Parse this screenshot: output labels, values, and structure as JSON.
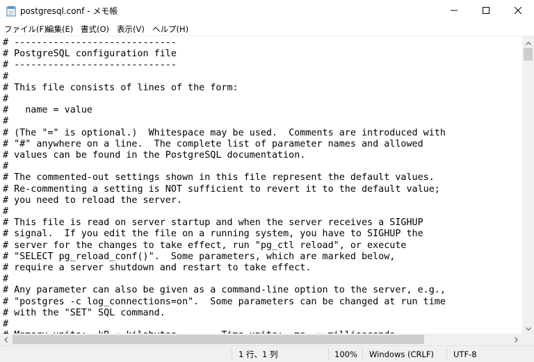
{
  "window": {
    "title": "postgresql.conf - メモ帳",
    "icon": "notepad-icon"
  },
  "menu": [
    {
      "label": "ファイル(F)"
    },
    {
      "label": "編集(E)"
    },
    {
      "label": "書式(O)"
    },
    {
      "label": "表示(V)"
    },
    {
      "label": "ヘルプ(H)"
    }
  ],
  "editor": {
    "lines": [
      "# -----------------------------",
      "# PostgreSQL configuration file",
      "# -----------------------------",
      "#",
      "# This file consists of lines of the form:",
      "#",
      "#   name = value",
      "#",
      "# (The \"=\" is optional.)  Whitespace may be used.  Comments are introduced with",
      "# \"#\" anywhere on a line.  The complete list of parameter names and allowed",
      "# values can be found in the PostgreSQL documentation.",
      "#",
      "# The commented-out settings shown in this file represent the default values.",
      "# Re-commenting a setting is NOT sufficient to revert it to the default value;",
      "# you need to reload the server.",
      "#",
      "# This file is read on server startup and when the server receives a SIGHUP",
      "# signal.  If you edit the file on a running system, you have to SIGHUP the",
      "# server for the changes to take effect, run \"pg_ctl reload\", or execute",
      "# \"SELECT pg_reload_conf()\".  Some parameters, which are marked below,",
      "# require a server shutdown and restart to take effect.",
      "#",
      "# Any parameter can also be given as a command-line option to the server, e.g.,",
      "# \"postgres -c log_connections=on\".  Some parameters can be changed at run time",
      "# with the \"SET\" SQL command.",
      "#",
      "# Memory units:  kB = kilobytes        Time units:  ms  = milliseconds"
    ]
  },
  "status": {
    "position": "1 行、1 列",
    "zoom": "100%",
    "line_ending": "Windows (CRLF)",
    "encoding": "UTF-8"
  }
}
